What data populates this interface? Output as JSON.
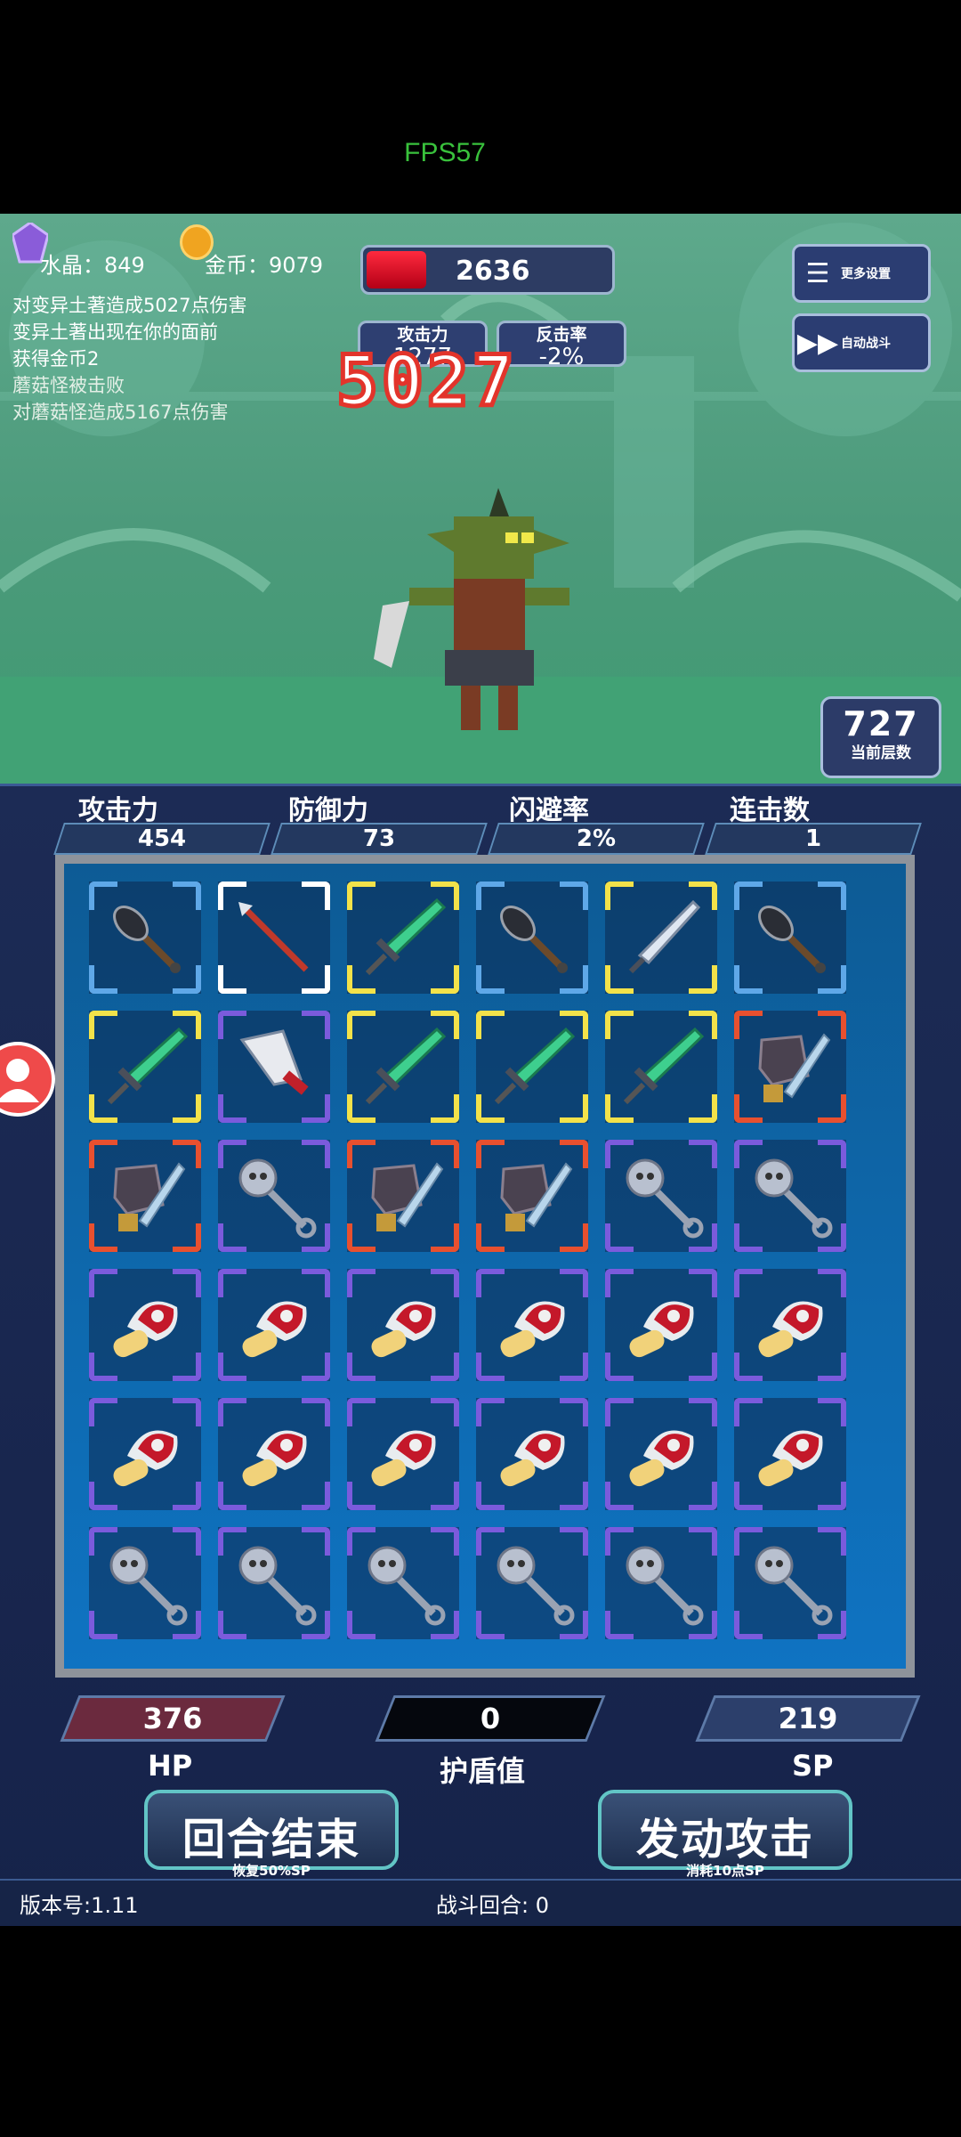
{
  "status": {
    "fps": "FPS57"
  },
  "header": {
    "crystal_label": "水晶：849",
    "gold_label": "金币：9079",
    "enemy_hp": "2636",
    "enemy_hp_fraction": 0.24,
    "enemy_attack_label": "攻击力",
    "enemy_attack_value": "1277",
    "enemy_counter_label": "反击率",
    "enemy_counter_value": "-2%",
    "damage_popup": "5027",
    "more_settings": "更多设置",
    "auto_battle": "自动战斗",
    "floor_value": "727",
    "floor_label": "当前层数"
  },
  "log": [
    "对变异土著造成5027点伤害",
    "变异土著出现在你的面前",
    "获得金币2",
    "蘑菇怪被击败",
    "对蘑菇怪造成5167点伤害"
  ],
  "player_stats": {
    "attack_label": "攻击力",
    "attack_value": "454",
    "defense_label": "防御力",
    "defense_value": "73",
    "dodge_label": "闪避率",
    "dodge_value": "2%",
    "combo_label": "连击数",
    "combo_value": "1"
  },
  "grid": [
    [
      {
        "item": "spiked-club",
        "rarity": "blue"
      },
      {
        "item": "red-spear",
        "rarity": "white"
      },
      {
        "item": "emerald-sword",
        "rarity": "yellow"
      },
      {
        "item": "spiked-club",
        "rarity": "blue"
      },
      {
        "item": "steel-dagger",
        "rarity": "yellow"
      },
      {
        "item": "spiked-club",
        "rarity": "blue"
      }
    ],
    [
      {
        "item": "emerald-sword",
        "rarity": "yellow"
      },
      {
        "item": "bloody-cleaver",
        "rarity": "purple"
      },
      {
        "item": "emerald-sword",
        "rarity": "yellow"
      },
      {
        "item": "emerald-sword",
        "rarity": "yellow"
      },
      {
        "item": "emerald-sword",
        "rarity": "yellow"
      },
      {
        "item": "dark-helmet-sword",
        "rarity": "red"
      }
    ],
    [
      {
        "item": "dark-helmet-sword",
        "rarity": "red"
      },
      {
        "item": "skull-mace",
        "rarity": "purple"
      },
      {
        "item": "dark-helmet-sword",
        "rarity": "red"
      },
      {
        "item": "dark-helmet-sword",
        "rarity": "red"
      },
      {
        "item": "skull-mace",
        "rarity": "purple"
      },
      {
        "item": "skull-mace",
        "rarity": "purple"
      }
    ],
    [
      {
        "item": "mushroom",
        "rarity": "purple"
      },
      {
        "item": "mushroom",
        "rarity": "purple"
      },
      {
        "item": "mushroom",
        "rarity": "purple"
      },
      {
        "item": "mushroom",
        "rarity": "purple"
      },
      {
        "item": "mushroom",
        "rarity": "purple"
      },
      {
        "item": "mushroom",
        "rarity": "purple"
      }
    ],
    [
      {
        "item": "mushroom",
        "rarity": "purple"
      },
      {
        "item": "mushroom",
        "rarity": "purple"
      },
      {
        "item": "mushroom",
        "rarity": "purple"
      },
      {
        "item": "mushroom",
        "rarity": "purple"
      },
      {
        "item": "mushroom",
        "rarity": "purple"
      },
      {
        "item": "mushroom",
        "rarity": "purple"
      }
    ],
    [
      {
        "item": "skull-mace",
        "rarity": "purple"
      },
      {
        "item": "skull-mace",
        "rarity": "purple"
      },
      {
        "item": "skull-mace",
        "rarity": "purple"
      },
      {
        "item": "skull-mace",
        "rarity": "purple"
      },
      {
        "item": "skull-mace",
        "rarity": "purple"
      },
      {
        "item": "skull-mace",
        "rarity": "purple"
      }
    ]
  ],
  "rarity_colors": {
    "blue": "#5fa8e8",
    "white": "#ffffff",
    "yellow": "#f3e24a",
    "purple": "#7b5bdc",
    "red": "#e8502f"
  },
  "bottom": {
    "hp_value": "376",
    "hp_label": "HP",
    "shield_value": "0",
    "shield_label": "护盾值",
    "sp_value": "219",
    "sp_label": "SP",
    "end_turn": "回合结束",
    "end_turn_sub": "恢复50%SP",
    "attack": "发动攻击",
    "attack_sub": "消耗10点SP",
    "version": "版本号:1.11",
    "round": "战斗回合:  0"
  },
  "icons": [
    "crystal-icon",
    "gold-coin-icon",
    "menu-list-icon",
    "fast-forward-icon",
    "user-icon"
  ]
}
